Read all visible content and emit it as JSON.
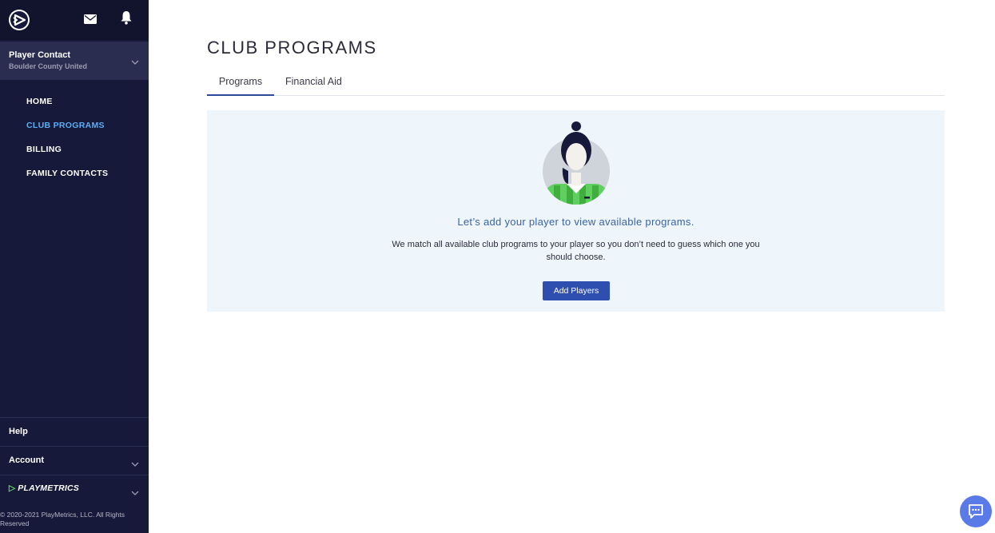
{
  "sidebar": {
    "contact": {
      "name": "Player Contact",
      "club": "Boulder County United"
    },
    "nav": [
      {
        "label": "HOME"
      },
      {
        "label": "CLUB PROGRAMS"
      },
      {
        "label": "BILLING"
      },
      {
        "label": "FAMILY CONTACTS"
      }
    ],
    "help_label": "Help",
    "account_label": "Account",
    "brand_label": "PLAYMETRICS",
    "copyright": "© 2020-2021 PlayMetrics, LLC. All Rights Reserved"
  },
  "main": {
    "title": "CLUB PROGRAMS",
    "tabs": [
      {
        "label": "Programs"
      },
      {
        "label": "Financial Aid"
      }
    ],
    "empty_state": {
      "heading": "Let’s add your player to view available programs.",
      "text": "We match all available club programs to your player so you don’t need to guess which one you should choose.",
      "button_label": "Add Players"
    }
  },
  "colors": {
    "sidebar_bg": "#17193a",
    "active_nav": "#5aaef5",
    "accent": "#2f4fb0",
    "card_bg": "#eef6fb",
    "brand_green": "#6cd76c"
  },
  "icons": [
    "playmetrics-logo-icon",
    "mail-icon",
    "bell-icon",
    "chevron-down-icon",
    "player-avatar-icon",
    "chat-icon"
  ]
}
